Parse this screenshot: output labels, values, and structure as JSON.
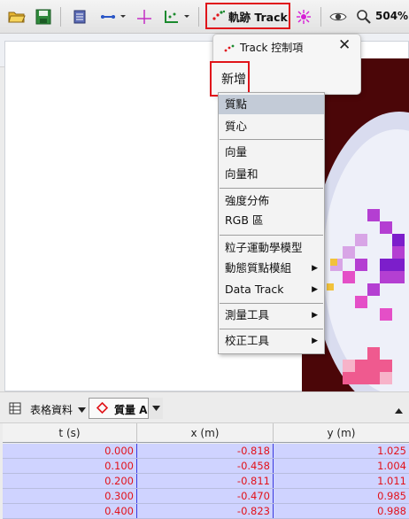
{
  "toolbar": {
    "track_label": "軌跡 Track",
    "zoom": "504%"
  },
  "popup": {
    "title": "Track 控制項",
    "close": "✕",
    "new_label": "新增"
  },
  "menu": {
    "items": [
      {
        "label": "質點",
        "submenu": false,
        "selected": true
      },
      {
        "label": "質心",
        "submenu": false
      },
      {
        "label": "向量",
        "submenu": false
      },
      {
        "label": "向量和",
        "submenu": false
      },
      {
        "label": "強度分佈",
        "submenu": false
      },
      {
        "label": "RGB 區",
        "submenu": false
      },
      {
        "label": "粒子運動學模型",
        "submenu": false
      },
      {
        "label": "動態質點模組",
        "submenu": true
      },
      {
        "label": "Data Track",
        "submenu": true
      },
      {
        "label": "測量工具",
        "submenu": true
      },
      {
        "label": "校正工具",
        "submenu": true
      }
    ]
  },
  "table_bar": {
    "data_label": "表格資料",
    "track_name": "質量 A"
  },
  "table": {
    "columns": [
      "t (s)",
      "x (m)",
      "y (m)"
    ],
    "rows": [
      [
        "0.000",
        "-0.818",
        "1.025"
      ],
      [
        "0.100",
        "-0.458",
        "1.004"
      ],
      [
        "0.200",
        "-0.811",
        "1.011"
      ],
      [
        "0.300",
        "-0.470",
        "0.985"
      ],
      [
        "0.400",
        "-0.823",
        "0.988"
      ]
    ]
  },
  "colors": {
    "highlight": "#e0141a",
    "value_text": "#e2121a",
    "row_bg": "#cfd3ff"
  },
  "icons": [
    "open-folder-icon",
    "save-icon",
    "clip-settings-icon",
    "calibration-icon",
    "axes-icon",
    "track-icon",
    "pencil-icon",
    "eye-icon",
    "zoom-icon"
  ]
}
